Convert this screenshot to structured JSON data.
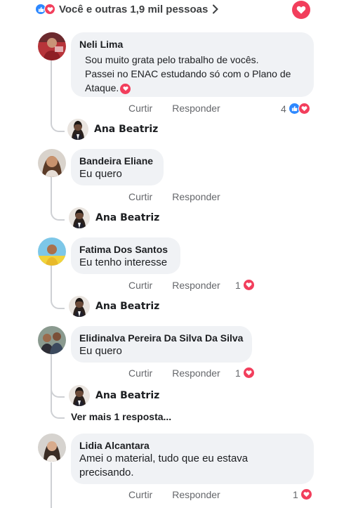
{
  "top_bar": {
    "reactions_text": "Você e outras 1,9 mil pessoas",
    "icons": [
      "like-icon",
      "love-icon"
    ]
  },
  "actions": {
    "like": "Curtir",
    "reply": "Responder"
  },
  "comments": [
    {
      "author": "Neli Lima",
      "text_line1": "Sou muito grata pelo trabalho de vocês.",
      "text_line2": "Passei no ENAC estudando só com o Plano de",
      "text_line3": "Ataque.",
      "reaction_count": "4",
      "reply_author": "Ana Beatriz"
    },
    {
      "author": "Bandeira Eliane",
      "text": "Eu quero",
      "reply_author": "Ana Beatriz"
    },
    {
      "author": "Fatima Dos Santos",
      "text": "Eu tenho interesse",
      "reaction_count": "1",
      "reply_author": "Ana Beatriz"
    },
    {
      "author": "Elidinalva Pereira Da Silva Da Silva",
      "text": "Eu quero",
      "reaction_count": "1",
      "reply_author": "Ana Beatriz",
      "more_replies": "Ver mais 1 resposta..."
    },
    {
      "author": "Lidia Alcantara",
      "text_line1": "Amei o material, tudo que eu estava",
      "text_line2": "precisando.",
      "reaction_count": "1"
    }
  ],
  "colors": {
    "like_blue": "#2d88ff",
    "love_red": "#f23e5c",
    "bubble_gray": "#f0f2f5",
    "meta_gray": "#65676b"
  }
}
